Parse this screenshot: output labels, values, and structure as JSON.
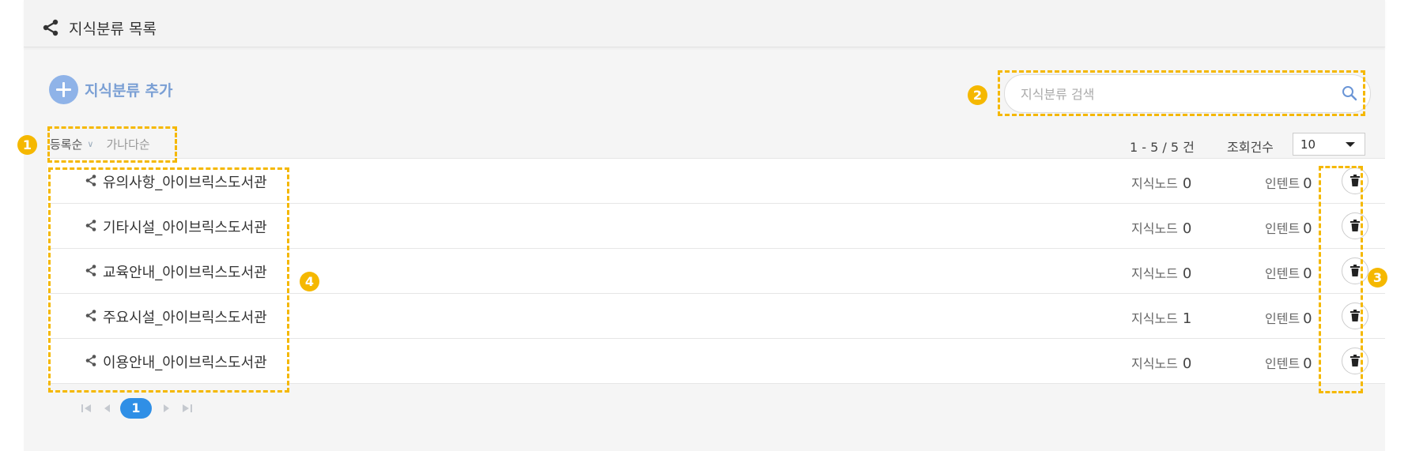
{
  "header": {
    "title": "지식분류 목록",
    "icon": "share-icon"
  },
  "toolbar": {
    "add_label": "지식분류 추가",
    "add_icon": "plus-circle-icon"
  },
  "search": {
    "placeholder": "지식분류 검색",
    "value": "",
    "icon": "search-icon"
  },
  "sort": {
    "active": "등록순",
    "alternate": "가나다순"
  },
  "summary": {
    "count_text": "1 - 5 / 5 건",
    "page_size_label": "조회건수",
    "page_size_value": "10"
  },
  "columns": {
    "node_label": "지식노드",
    "intent_label": "인텐트"
  },
  "items": [
    {
      "name": "유의사항_아이브릭스도서관",
      "nodes": "0",
      "intents": "0"
    },
    {
      "name": "기타시설_아이브릭스도서관",
      "nodes": "0",
      "intents": "0"
    },
    {
      "name": "교육안내_아이브릭스도서관",
      "nodes": "0",
      "intents": "0"
    },
    {
      "name": "주요시설_아이브릭스도서관",
      "nodes": "1",
      "intents": "0"
    },
    {
      "name": "이용안내_아이브릭스도서관",
      "nodes": "0",
      "intents": "0"
    }
  ],
  "pagination": {
    "current_page": "1"
  },
  "annotations": {
    "badge1": "1",
    "badge2": "2",
    "badge3": "3",
    "badge4": "4"
  },
  "colors": {
    "accent": "#2f8fe6",
    "add_button": "#8fb3e8",
    "annotation": "#f5b800"
  }
}
